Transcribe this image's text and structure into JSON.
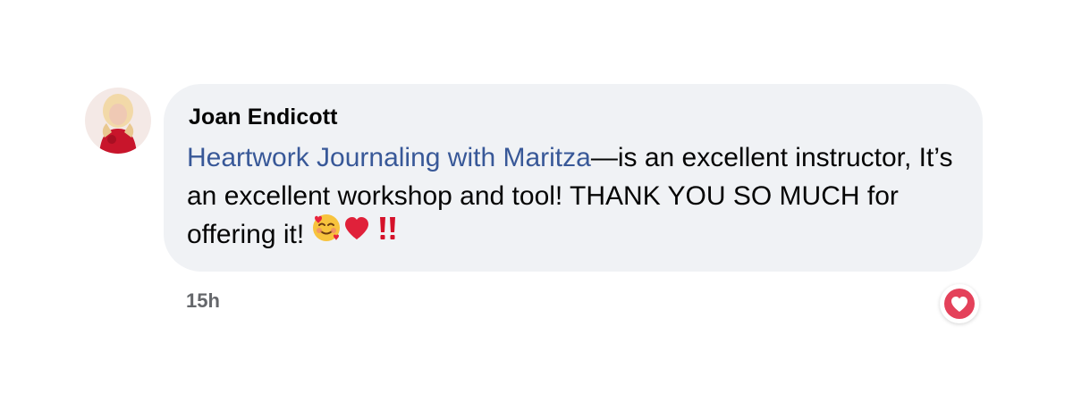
{
  "comment": {
    "author": "Joan Endicott",
    "mention": "Heartwork Journaling with Maritza",
    "body_text": "—is an excellent instructor, It’s an excellent workshop and tool! THANK YOU SO MUCH for offering it!",
    "emojis": [
      "smiling-face-with-hearts",
      "red-heart",
      "double-exclamation-mark"
    ],
    "timestamp": "15h",
    "reaction": "love",
    "colors": {
      "bubble": "#f0f2f5",
      "mention": "#385898",
      "text": "#050505",
      "timestamp": "#65676b",
      "love_reaction": "#e4415a"
    }
  }
}
